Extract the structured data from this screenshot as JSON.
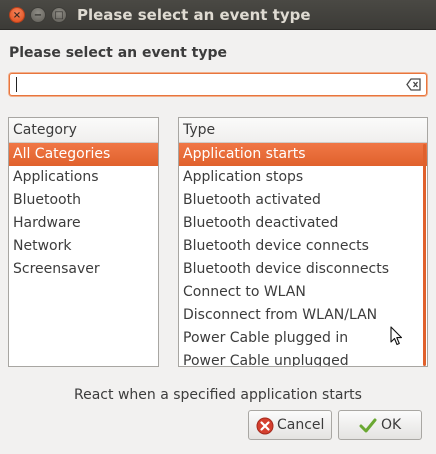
{
  "window": {
    "title": "Please select an event type",
    "close_glyph": "×",
    "minimize_glyph": "−",
    "maximize_glyph": "□"
  },
  "dialog": {
    "heading": "Please select an event type",
    "search": {
      "value": "",
      "placeholder": ""
    }
  },
  "category": {
    "header": "Category",
    "items": [
      {
        "label": "All Categories",
        "selected": true
      },
      {
        "label": "Applications",
        "selected": false
      },
      {
        "label": "Bluetooth",
        "selected": false
      },
      {
        "label": "Hardware",
        "selected": false
      },
      {
        "label": "Network",
        "selected": false
      },
      {
        "label": "Screensaver",
        "selected": false
      }
    ]
  },
  "type": {
    "header": "Type",
    "items": [
      {
        "label": "Application starts",
        "selected": true
      },
      {
        "label": "Application stops",
        "selected": false
      },
      {
        "label": "Bluetooth activated",
        "selected": false
      },
      {
        "label": "Bluetooth deactivated",
        "selected": false
      },
      {
        "label": "Bluetooth device connects",
        "selected": false
      },
      {
        "label": "Bluetooth device disconnects",
        "selected": false
      },
      {
        "label": "Connect to WLAN",
        "selected": false
      },
      {
        "label": "Disconnect from WLAN/LAN",
        "selected": false
      },
      {
        "label": "Power Cable plugged in",
        "selected": false
      },
      {
        "label": "Power Cable unplugged",
        "selected": false
      }
    ]
  },
  "status_text": "React when a specified application starts",
  "buttons": {
    "cancel": "Cancel",
    "ok": "OK"
  },
  "colors": {
    "accent": "#e8673a",
    "window_bg": "#f2f1f0",
    "titlebar": "#3c3b37"
  }
}
